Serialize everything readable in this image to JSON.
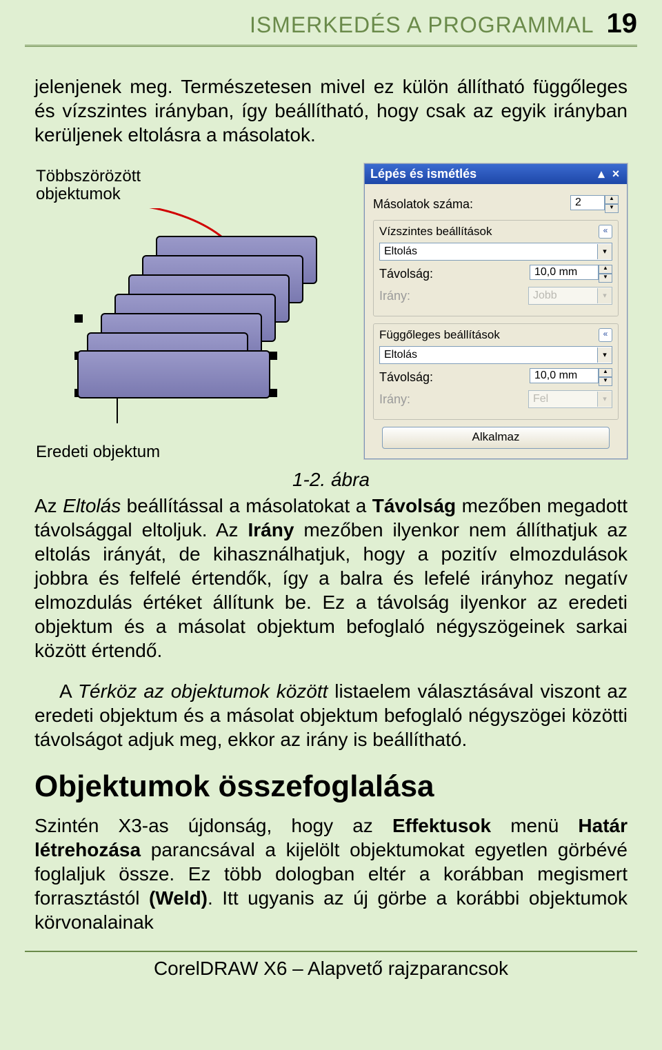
{
  "header": {
    "title": "ISMERKEDÉS A PROGRAMMAL",
    "page_number": "19"
  },
  "paragraphs": {
    "p1": "jelenjenek meg. Természetesen mivel ez külön állítható függőleges és vízszintes irányban, így beállítható, hogy csak az egyik irányban kerüljenek eltolásra a másolatok.",
    "caption": "1-2. ábra",
    "p2_a": "Az ",
    "p2_b_italic": "Eltolás",
    "p2_c": " beállítással a másolatokat a ",
    "p2_d_bold": "Távolság",
    "p2_e": " mezőben megadott távolsággal eltoljuk. Az ",
    "p2_f_bold": "Irány",
    "p2_g": " mezőben ilyenkor nem állíthatjuk az eltolás irányát, de kihasználhatjuk, hogy a pozitív elmozdulások jobbra és felfelé értendők, így a balra és lefelé irányhoz negatív elmozdulás értéket állítunk be. Ez a távolság ilyenkor az eredeti objektum és a másolat objektum befoglaló négyszögeinek sarkai között értendő.",
    "p3_a": "A ",
    "p3_b_italic": "Térköz az objektumok között",
    "p3_c": " listaelem választásával viszont az eredeti objektum és a másolat objektum befoglaló négyszögei közötti távolságot adjuk meg, ekkor az irány is beállítható.",
    "h2": "Objektumok összefoglalása",
    "p4_a": "Szintén X3-as újdonság, hogy az ",
    "p4_b_bold": "Effektusok",
    "p4_c": " menü ",
    "p4_d_bold": "Határ létrehozása",
    "p4_e": " parancsával a kijelölt objektumokat egyetlen görbévé foglaljuk össze. Ez több dologban eltér a korábban megismert forrasztástól ",
    "p4_f_bold": "(Weld)",
    "p4_g": ". Itt ugyanis az új görbe a korábbi objektumok körvonalainak"
  },
  "figure": {
    "callout_top": "Többszörözött\nobjektumok",
    "callout_bottom": "Eredeti objektum"
  },
  "docker": {
    "title": "Lépés és ismétlés",
    "copies_label": "Másolatok száma:",
    "copies_value": "2",
    "group_h": {
      "title": "Vízszintes beállítások",
      "mode": "Eltolás",
      "dist_label": "Távolság:",
      "dist_value": "10,0 mm",
      "dir_label": "Irány:",
      "dir_value": "Jobb"
    },
    "group_v": {
      "title": "Függőleges beállítások",
      "mode": "Eltolás",
      "dist_label": "Távolság:",
      "dist_value": "10,0 mm",
      "dir_label": "Irány:",
      "dir_value": "Fel"
    },
    "apply": "Alkalmaz"
  },
  "footer": "CorelDRAW X6 – Alapvető rajzparancsok"
}
